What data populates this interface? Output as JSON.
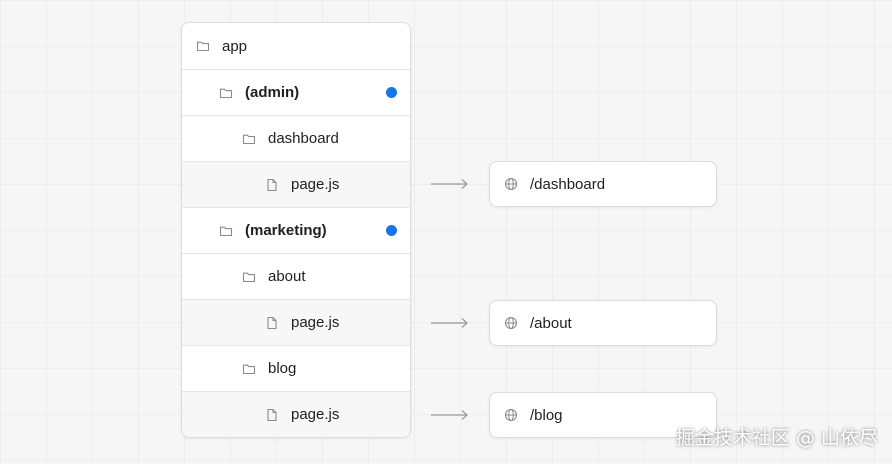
{
  "colors": {
    "route_group_dot": "#1a73e8"
  },
  "tree": [
    {
      "label": "app",
      "type": "folder",
      "icon": "folder-icon"
    },
    {
      "label": "(admin)",
      "type": "folder",
      "icon": "folder-icon",
      "bold": true,
      "dot": true
    },
    {
      "label": "dashboard",
      "type": "folder",
      "icon": "folder-icon"
    },
    {
      "label": "page.js",
      "type": "file",
      "icon": "file-icon"
    },
    {
      "label": "(marketing)",
      "type": "folder",
      "icon": "folder-icon",
      "bold": true,
      "dot": true
    },
    {
      "label": "about",
      "type": "folder",
      "icon": "folder-icon"
    },
    {
      "label": "page.js",
      "type": "file",
      "icon": "file-icon"
    },
    {
      "label": "blog",
      "type": "folder",
      "icon": "folder-icon"
    },
    {
      "label": "page.js",
      "type": "file",
      "icon": "file-icon"
    }
  ],
  "routes": [
    {
      "path": "/dashboard",
      "icon": "globe-icon"
    },
    {
      "path": "/about",
      "icon": "globe-icon"
    },
    {
      "path": "/blog",
      "icon": "globe-icon"
    }
  ],
  "watermark": "掘金技术社区 @ 山依尽"
}
